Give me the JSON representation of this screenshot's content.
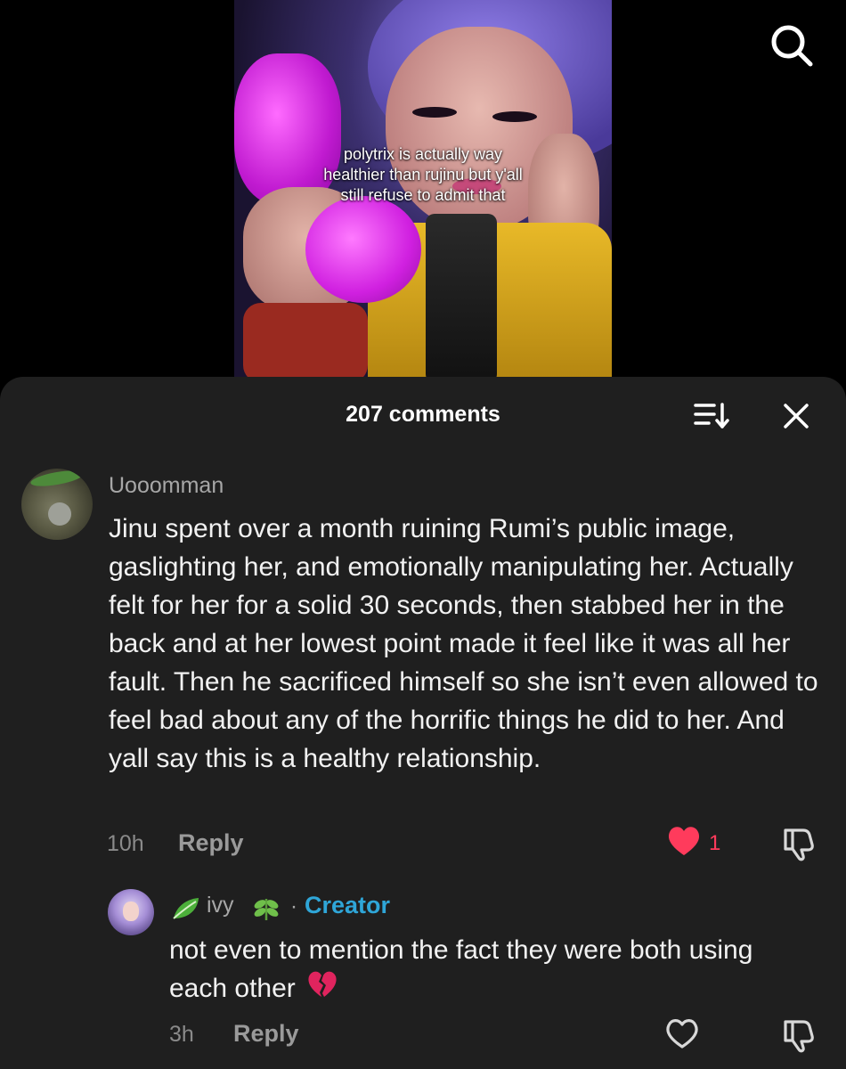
{
  "video": {
    "caption": "polytrix is actually way healthier than rujinu but y'all still refuse to admit that"
  },
  "icons": {
    "search": "search-icon",
    "sort": "sort-icon",
    "close": "close-icon",
    "like": "heart-icon",
    "dislike": "thumbs-down-icon",
    "broken_heart": "broken-heart-emoji",
    "leaf": "leaf-emoji"
  },
  "comments_header": {
    "title": "207 comments"
  },
  "comments": [
    {
      "username": "Uooomman",
      "text": "Jinu spent over a month ruining Rumi’s public image, gaslighting her, and emotionally manipulating her. Actually felt for her for a solid 30 seconds, then stabbed her in the back and at her lowest point made it feel like it was all her fault. Then he sacrificed himself so she isn’t even allowed to feel bad about any of the horrific things he did to her. And yall say this is a healthy relationship.",
      "time": "10h",
      "reply_label": "Reply",
      "likes": "1",
      "liked": true
    }
  ],
  "reply": {
    "username": "ivy",
    "separator": "·",
    "badge": "Creator",
    "text": "not even to mention the fact they were both using each other",
    "time": "3h",
    "reply_label": "Reply",
    "liked": false
  },
  "colors": {
    "sheet_bg": "#1f1f1f",
    "like_active": "#ff3b5c",
    "creator": "#2fa6d8"
  }
}
